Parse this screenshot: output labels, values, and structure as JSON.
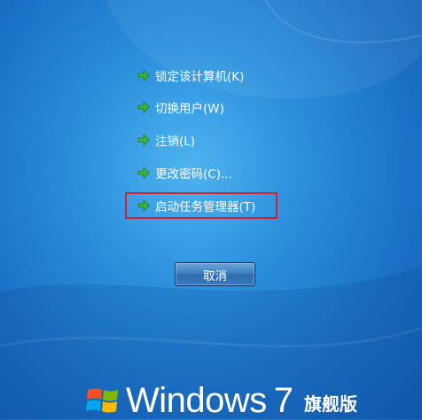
{
  "menu": {
    "items": [
      {
        "label": "锁定该计算机(K)"
      },
      {
        "label": "切换用户(W)"
      },
      {
        "label": "注销(L)"
      },
      {
        "label": "更改密码(C)..."
      },
      {
        "label": "启动任务管理器(T)"
      }
    ],
    "highlighted_index": 4
  },
  "cancel_button": {
    "label": "取消"
  },
  "branding": {
    "word": "Windows",
    "version": "7",
    "edition": "旗舰版"
  },
  "colors": {
    "background": "#2a8fdc",
    "arrow_green": "#3db33b",
    "highlight_border": "#d8202a",
    "text": "#ffffff"
  }
}
